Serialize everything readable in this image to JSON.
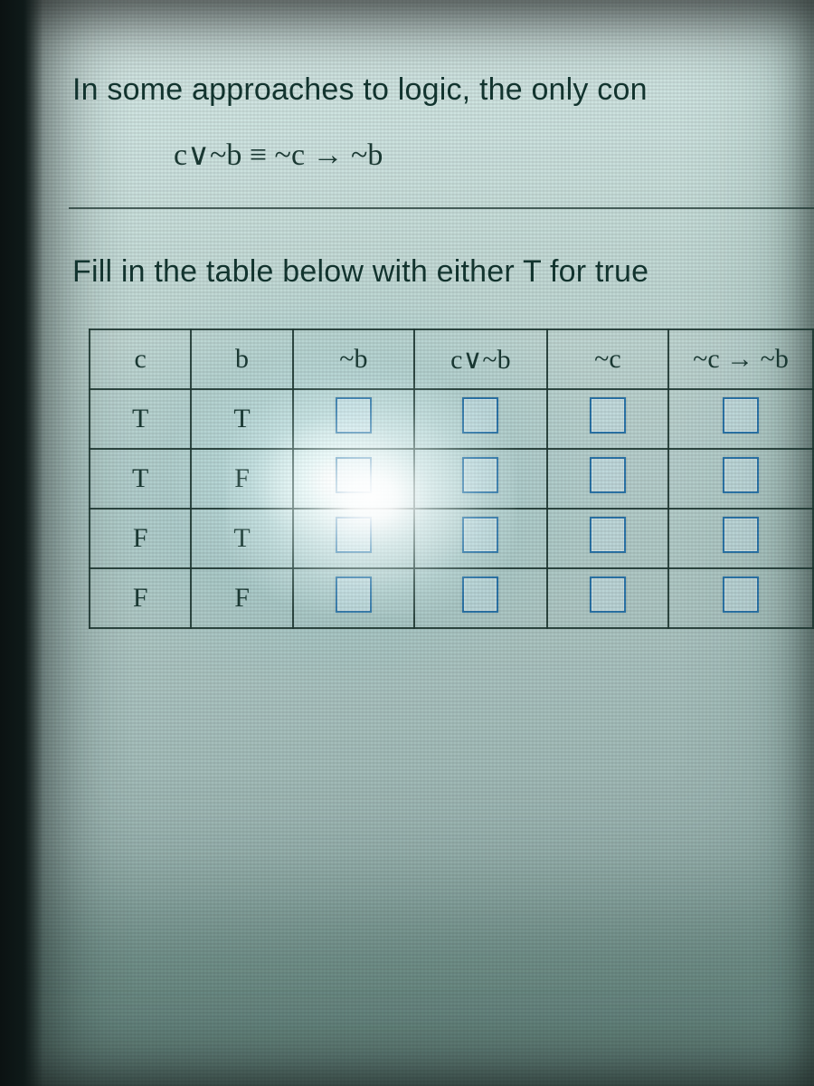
{
  "intro_line": "In some approaches to logic, the only con",
  "expression": "c∨~b ≡ ~c → ~b",
  "instruction": "Fill in the table below with either T for true",
  "table": {
    "headers": [
      "c",
      "b",
      "~b",
      "c∨~b",
      "~c",
      "~c → ~b"
    ],
    "rows": [
      {
        "c": "T",
        "b": "T"
      },
      {
        "c": "T",
        "b": "F"
      },
      {
        "c": "F",
        "b": "T"
      },
      {
        "c": "F",
        "b": "F"
      }
    ]
  }
}
